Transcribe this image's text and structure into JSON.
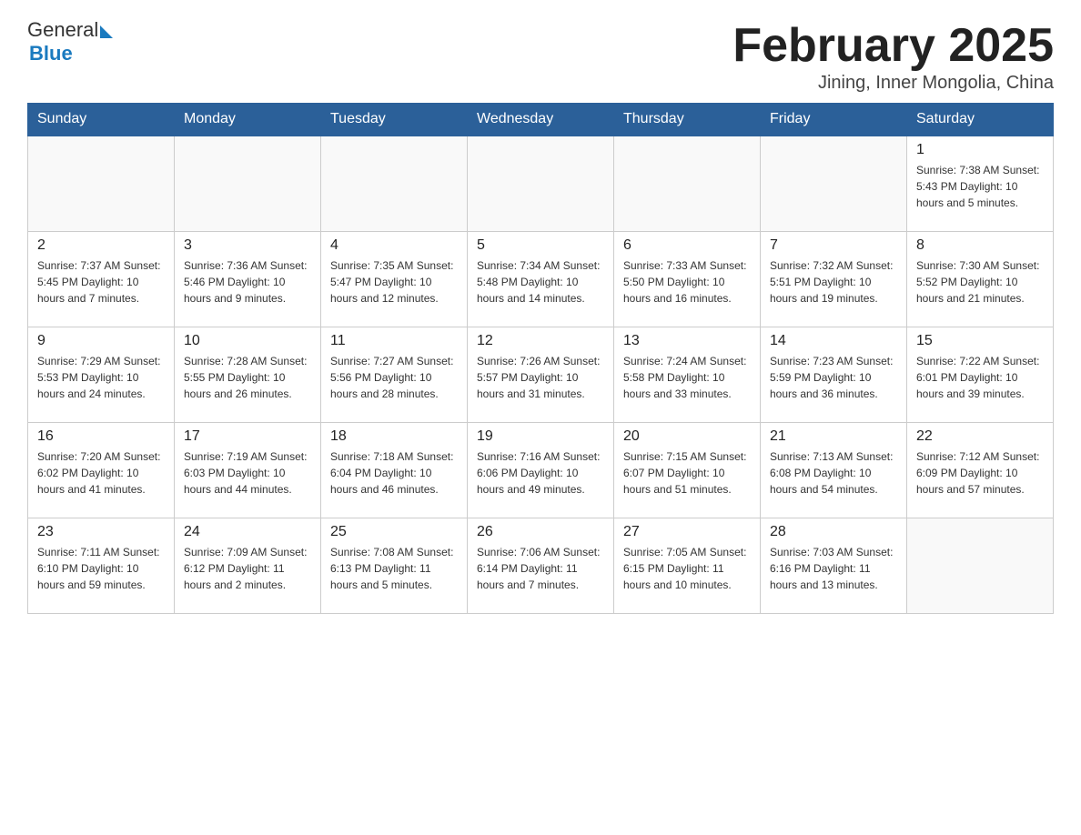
{
  "header": {
    "logo_general": "General",
    "logo_blue": "Blue",
    "title": "February 2025",
    "location": "Jining, Inner Mongolia, China"
  },
  "days_of_week": [
    "Sunday",
    "Monday",
    "Tuesday",
    "Wednesday",
    "Thursday",
    "Friday",
    "Saturday"
  ],
  "weeks": [
    [
      {
        "day": "",
        "info": ""
      },
      {
        "day": "",
        "info": ""
      },
      {
        "day": "",
        "info": ""
      },
      {
        "day": "",
        "info": ""
      },
      {
        "day": "",
        "info": ""
      },
      {
        "day": "",
        "info": ""
      },
      {
        "day": "1",
        "info": "Sunrise: 7:38 AM\nSunset: 5:43 PM\nDaylight: 10 hours and 5 minutes."
      }
    ],
    [
      {
        "day": "2",
        "info": "Sunrise: 7:37 AM\nSunset: 5:45 PM\nDaylight: 10 hours and 7 minutes."
      },
      {
        "day": "3",
        "info": "Sunrise: 7:36 AM\nSunset: 5:46 PM\nDaylight: 10 hours and 9 minutes."
      },
      {
        "day": "4",
        "info": "Sunrise: 7:35 AM\nSunset: 5:47 PM\nDaylight: 10 hours and 12 minutes."
      },
      {
        "day": "5",
        "info": "Sunrise: 7:34 AM\nSunset: 5:48 PM\nDaylight: 10 hours and 14 minutes."
      },
      {
        "day": "6",
        "info": "Sunrise: 7:33 AM\nSunset: 5:50 PM\nDaylight: 10 hours and 16 minutes."
      },
      {
        "day": "7",
        "info": "Sunrise: 7:32 AM\nSunset: 5:51 PM\nDaylight: 10 hours and 19 minutes."
      },
      {
        "day": "8",
        "info": "Sunrise: 7:30 AM\nSunset: 5:52 PM\nDaylight: 10 hours and 21 minutes."
      }
    ],
    [
      {
        "day": "9",
        "info": "Sunrise: 7:29 AM\nSunset: 5:53 PM\nDaylight: 10 hours and 24 minutes."
      },
      {
        "day": "10",
        "info": "Sunrise: 7:28 AM\nSunset: 5:55 PM\nDaylight: 10 hours and 26 minutes."
      },
      {
        "day": "11",
        "info": "Sunrise: 7:27 AM\nSunset: 5:56 PM\nDaylight: 10 hours and 28 minutes."
      },
      {
        "day": "12",
        "info": "Sunrise: 7:26 AM\nSunset: 5:57 PM\nDaylight: 10 hours and 31 minutes."
      },
      {
        "day": "13",
        "info": "Sunrise: 7:24 AM\nSunset: 5:58 PM\nDaylight: 10 hours and 33 minutes."
      },
      {
        "day": "14",
        "info": "Sunrise: 7:23 AM\nSunset: 5:59 PM\nDaylight: 10 hours and 36 minutes."
      },
      {
        "day": "15",
        "info": "Sunrise: 7:22 AM\nSunset: 6:01 PM\nDaylight: 10 hours and 39 minutes."
      }
    ],
    [
      {
        "day": "16",
        "info": "Sunrise: 7:20 AM\nSunset: 6:02 PM\nDaylight: 10 hours and 41 minutes."
      },
      {
        "day": "17",
        "info": "Sunrise: 7:19 AM\nSunset: 6:03 PM\nDaylight: 10 hours and 44 minutes."
      },
      {
        "day": "18",
        "info": "Sunrise: 7:18 AM\nSunset: 6:04 PM\nDaylight: 10 hours and 46 minutes."
      },
      {
        "day": "19",
        "info": "Sunrise: 7:16 AM\nSunset: 6:06 PM\nDaylight: 10 hours and 49 minutes."
      },
      {
        "day": "20",
        "info": "Sunrise: 7:15 AM\nSunset: 6:07 PM\nDaylight: 10 hours and 51 minutes."
      },
      {
        "day": "21",
        "info": "Sunrise: 7:13 AM\nSunset: 6:08 PM\nDaylight: 10 hours and 54 minutes."
      },
      {
        "day": "22",
        "info": "Sunrise: 7:12 AM\nSunset: 6:09 PM\nDaylight: 10 hours and 57 minutes."
      }
    ],
    [
      {
        "day": "23",
        "info": "Sunrise: 7:11 AM\nSunset: 6:10 PM\nDaylight: 10 hours and 59 minutes."
      },
      {
        "day": "24",
        "info": "Sunrise: 7:09 AM\nSunset: 6:12 PM\nDaylight: 11 hours and 2 minutes."
      },
      {
        "day": "25",
        "info": "Sunrise: 7:08 AM\nSunset: 6:13 PM\nDaylight: 11 hours and 5 minutes."
      },
      {
        "day": "26",
        "info": "Sunrise: 7:06 AM\nSunset: 6:14 PM\nDaylight: 11 hours and 7 minutes."
      },
      {
        "day": "27",
        "info": "Sunrise: 7:05 AM\nSunset: 6:15 PM\nDaylight: 11 hours and 10 minutes."
      },
      {
        "day": "28",
        "info": "Sunrise: 7:03 AM\nSunset: 6:16 PM\nDaylight: 11 hours and 13 minutes."
      },
      {
        "day": "",
        "info": ""
      }
    ]
  ]
}
